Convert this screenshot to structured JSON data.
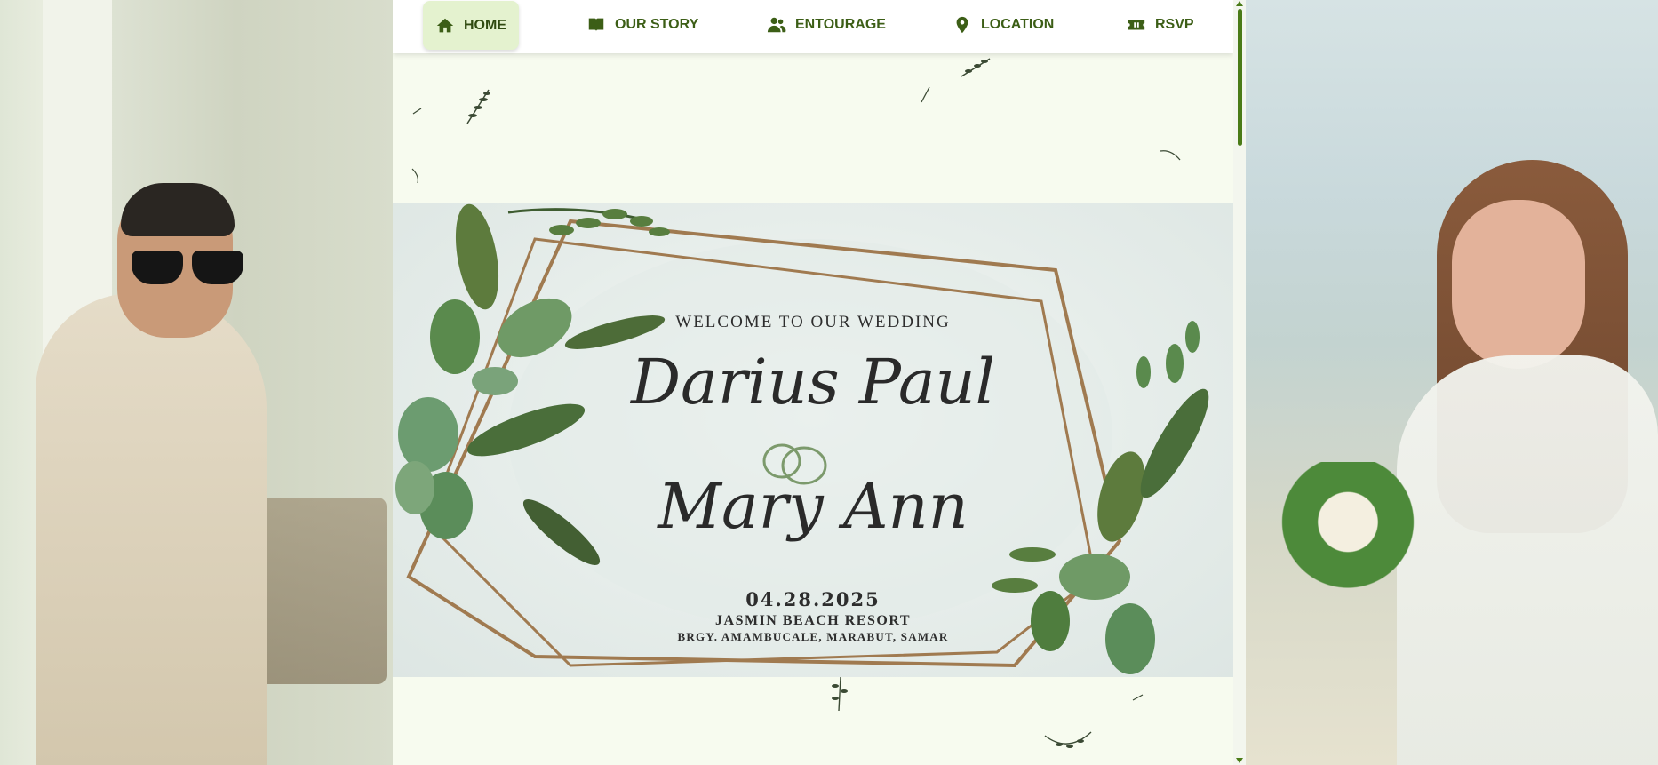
{
  "nav": {
    "items": [
      {
        "label": "HOME",
        "icon": "home-icon"
      },
      {
        "label": "OUR STORY",
        "icon": "book-icon"
      },
      {
        "label": "ENTOURAGE",
        "icon": "people-icon"
      },
      {
        "label": "LOCATION",
        "icon": "map-pin-icon"
      },
      {
        "label": "RSVP",
        "icon": "ticket-icon"
      }
    ],
    "active": "HOME"
  },
  "invitation": {
    "welcome": "WELCOME TO OUR WEDDING",
    "groom_name": "Darius Paul",
    "bride_name": "Mary Ann",
    "date": "04.28.2025",
    "venue": "JASMIN BEACH RESORT",
    "address": "BRGY. AMAMBUCALE, MARABUT, SAMAR"
  },
  "colors": {
    "accent": "#3c5e16",
    "nav_active_bg": "#e4f2cf",
    "frame_gold": "#a07a50",
    "page_bg": "#f7fbef"
  }
}
